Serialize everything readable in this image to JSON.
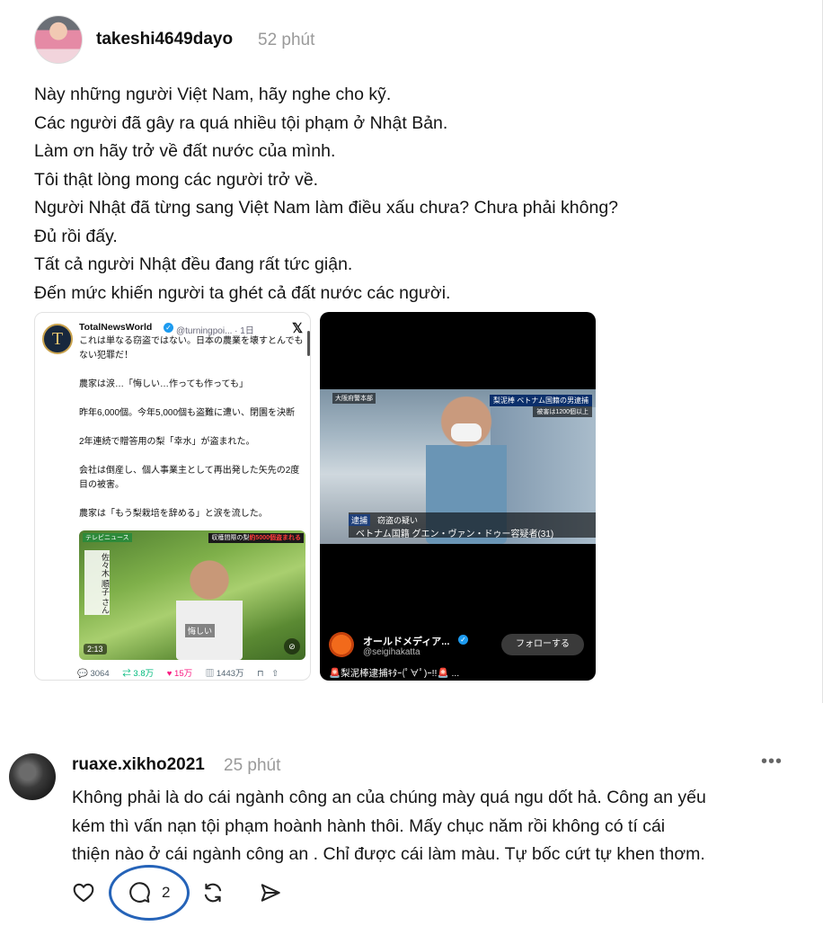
{
  "post": {
    "username": "takeshi4649dayo",
    "time": "52 phút",
    "lines": [
      "Này những người Việt Nam, hãy nghe cho kỹ.",
      "Các người đã gây ra quá nhiều tội phạm ở Nhật Bản.",
      "Làm ơn hãy trở về đất nước của mình.",
      "Tôi thật lòng mong các người trở về.",
      "Người Nhật đã từng sang Việt Nam làm điều xấu chưa? Chưa phải không?",
      "Đủ rồi đấy.",
      "Tất cả người Nhật đều đang rất tức giận.",
      "Đến mức khiến người ta ghét cả đất nước các người."
    ],
    "media1": {
      "avatar_letter": "T",
      "name": "TotalNewsWorld",
      "handle": "@turningpoi... · 1日",
      "paragraphs": [
        "これは単なる窃盗ではない。日本の農業を壊すとんでもない犯罪だ！",
        "農家は涙…「悔しい…作っても作っても」",
        "昨年6,000個。今年5,000個も盗難に遭い、閉園を決断",
        "2年連続で贈答用の梨「幸水」が盗まれた。",
        "会社は倒産し、個人事業主として再出発した矢先の2度目の被害。",
        "農家は「もう梨栽培を辞める」と涙を流した。"
      ],
      "video": {
        "tag": "テレビニュース",
        "ribbon_prefix": "収穫間際の梨",
        "ribbon_highlight": "約5000個盗まれる",
        "vertical_text": "佐々木 順子 さん",
        "caption": "悔しい",
        "duration": "2:13"
      },
      "stats": {
        "replies": "3064",
        "reposts": "3.8万",
        "likes": "15万",
        "views": "1443万"
      }
    },
    "media2": {
      "news_top_left": "大阪府警本部",
      "news_top_right": "梨泥棒 ベトナム国籍の男逮捕",
      "news_top_right2": "被害は1200個以上",
      "news_badge": "逮捕",
      "news_line1": "窃盗の疑い",
      "news_line2": "ベトナム国籍 グエン・ヴァン・ドゥー容疑者(31)",
      "channel_name": "オールドメディア...",
      "channel_handle": "@seigihakatta",
      "follow_label": "フォローする",
      "tagline": "🚨梨泥棒逮捕ｷﾀｰ(ﾟ∀ﾟ)ｰ!!🚨 ..."
    }
  },
  "comment": {
    "username": "ruaxe.xikho2021",
    "time": "25 phút",
    "more": "•••",
    "lines": [
      "Không phải là do cái ngành công an của chúng mày quá ngu dốt hả. Công an yếu",
      "kém thì vấn nạn tội phạm hoành hành thôi. Mấy chục năm rồi không có tí cái",
      "thiện nào ở cái ngành công an . Chỉ được cái làm màu. Tự bốc cứt tự khen thơm."
    ],
    "reply_count": "2"
  },
  "icons": {
    "like": "heart-icon",
    "reply": "comment-icon",
    "repost": "repost-icon",
    "share": "send-icon"
  },
  "colors": {
    "highlight_ring": "#2563b8",
    "twitter_blue": "#1d9bf0",
    "repost_green": "#00ba7c",
    "like_pink": "#f91880"
  }
}
